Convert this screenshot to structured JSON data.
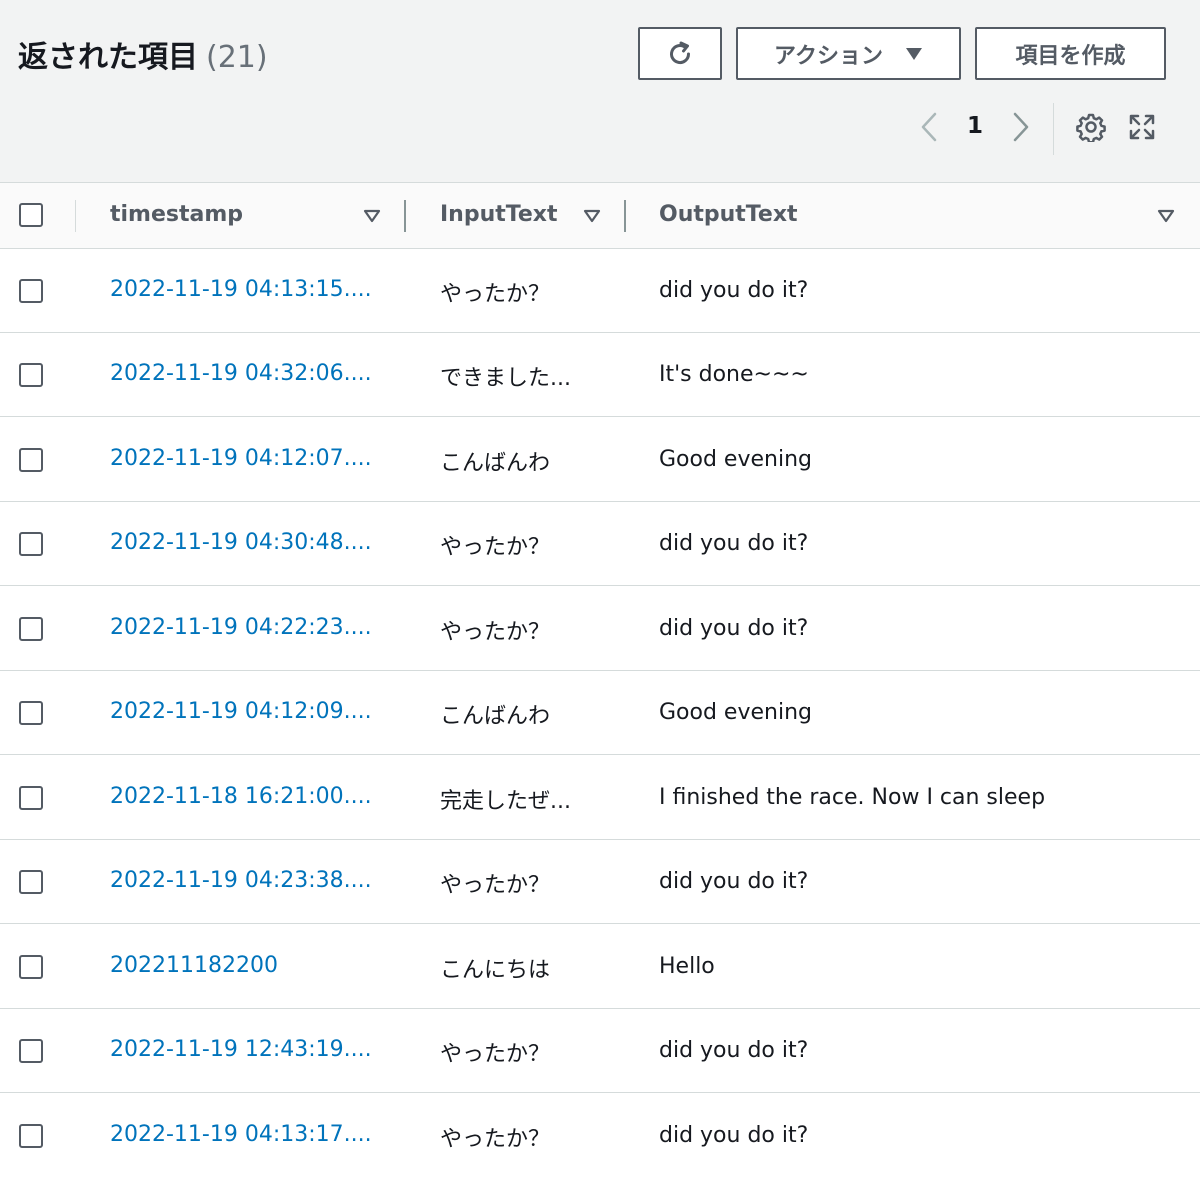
{
  "header": {
    "title": "返された項目",
    "count": "(21)",
    "actions_label": "アクション",
    "create_label": "項目を作成"
  },
  "pagination": {
    "current_page": "1"
  },
  "columns": [
    {
      "label": "timestamp"
    },
    {
      "label": "InputText"
    },
    {
      "label": "OutputText"
    }
  ],
  "rows": [
    {
      "timestamp": "2022-11-19 04:13:15....",
      "input": "やったか？",
      "output": "did you do it?"
    },
    {
      "timestamp": "2022-11-19 04:32:06....",
      "input": "できました...",
      "output": "It's done~~~"
    },
    {
      "timestamp": "2022-11-19 04:12:07....",
      "input": "こんばんわ",
      "output": "Good evening"
    },
    {
      "timestamp": "2022-11-19 04:30:48....",
      "input": "やったか？",
      "output": "did you do it?"
    },
    {
      "timestamp": "2022-11-19 04:22:23....",
      "input": "やったか？",
      "output": "did you do it?"
    },
    {
      "timestamp": "2022-11-19 04:12:09....",
      "input": "こんばんわ",
      "output": "Good evening"
    },
    {
      "timestamp": "2022-11-18 16:21:00....",
      "input": "完走したぜ...",
      "output": "I finished the race. Now I can sleep"
    },
    {
      "timestamp": "2022-11-19 04:23:38....",
      "input": "やったか？",
      "output": "did you do it?"
    },
    {
      "timestamp": "202211182200",
      "input": "こんにちは",
      "output": "Hello"
    },
    {
      "timestamp": "2022-11-19 12:43:19....",
      "input": "やったか？",
      "output": "did you do it?"
    },
    {
      "timestamp": "2022-11-19 04:13:17....",
      "input": "やったか？",
      "output": "did you do it?"
    }
  ],
  "colors": {
    "link": "#0073bb",
    "text": "#16191f",
    "secondary_text": "#545b64",
    "header_bg": "#f2f3f3",
    "border": "#d5dbdb"
  },
  "icons": {
    "refresh": "refresh-icon",
    "actions_caret": "caret-down-icon",
    "prev": "chevron-left-icon",
    "next": "chevron-right-icon",
    "settings": "gear-icon",
    "fullscreen": "fullscreen-icon",
    "sort": "sort-down-icon"
  }
}
